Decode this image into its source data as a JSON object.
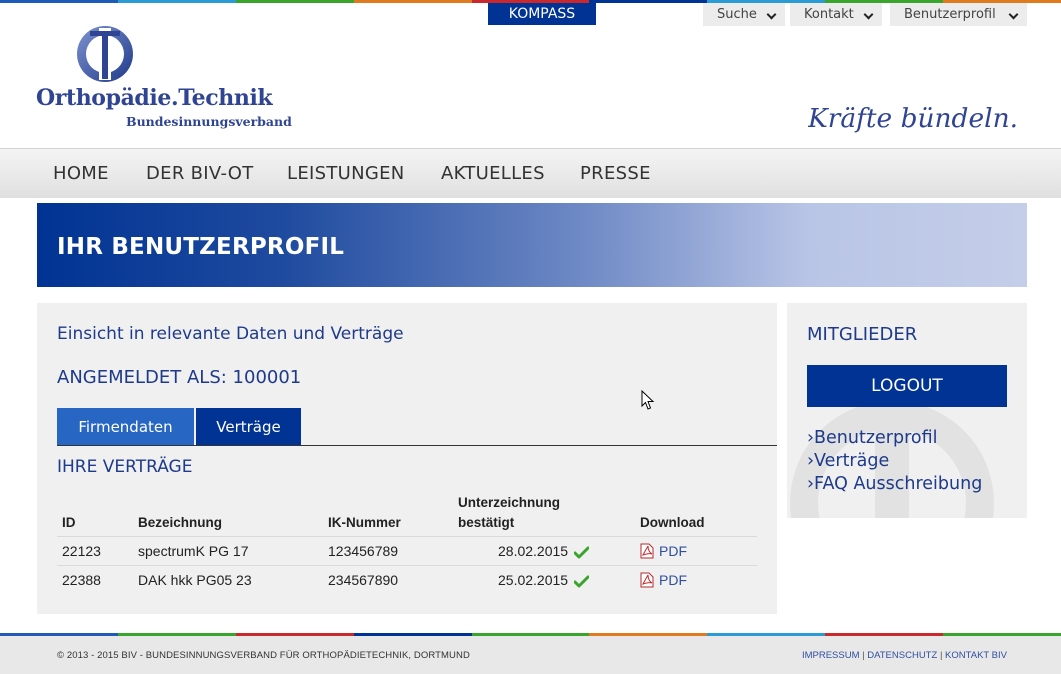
{
  "colors": {
    "brand_blue": "#003393",
    "tab_blue": "#2766c3",
    "accent_green": "#3aa52c"
  },
  "top_bar": {
    "kompass_label": "KOMPASS",
    "utility": [
      {
        "label": "Suche",
        "icon": "chevron-down-icon"
      },
      {
        "label": "Kontakt",
        "icon": "chevron-down-icon"
      },
      {
        "label": "Benutzerprofil",
        "icon": "chevron-down-icon"
      }
    ]
  },
  "logo": {
    "title": "Orthopädie.Technik",
    "subtitle": "Bundesinnungsverband"
  },
  "claim": "Kräfte bündeln.",
  "nav": [
    "HOME",
    "DER BIV-OT",
    "LEISTUNGEN",
    "AKTUELLES",
    "PRESSE"
  ],
  "banner": {
    "title": "IHR BENUTZERPROFIL"
  },
  "content": {
    "intro": "Einsicht in relevante Daten und Verträge",
    "logged_in": "ANGEMELDET ALS: 100001",
    "tabs": [
      {
        "label": "Firmendaten",
        "active": false
      },
      {
        "label": "Verträge",
        "active": true
      }
    ],
    "section_title": "IHRE VERTRÄGE",
    "table": {
      "headers": {
        "id": "ID",
        "bezeichnung": "Bezeichnung",
        "ik": "IK-Nummer",
        "unterzeichnung_1": "Unterzeichnung",
        "unterzeichnung_2": "bestätigt",
        "download": "Download"
      },
      "rows": [
        {
          "id": "22123",
          "bezeichnung": "spectrumK PG 17",
          "ik": "123456789",
          "datum": "28.02.2015",
          "download": "PDF"
        },
        {
          "id": "22388",
          "bezeichnung": "DAK hkk PG05 23",
          "ik": "234567890",
          "datum": "25.02.2015",
          "download": "PDF"
        }
      ]
    }
  },
  "sidebar": {
    "title": "MITGLIEDER",
    "logout_label": "LOGOUT",
    "links": [
      "›Benutzerprofil",
      "›Verträge",
      "›FAQ Ausschreibung"
    ]
  },
  "footer": {
    "copyright": "© 2013 - 2015 BIV - BUNDESINNUNGSVERBAND FÜR ORTHOPÄDIETECHNIK, DORTMUND",
    "links": [
      "IMPRESSUM",
      "DATENSCHUTZ",
      "KONTAKT BIV"
    ]
  }
}
